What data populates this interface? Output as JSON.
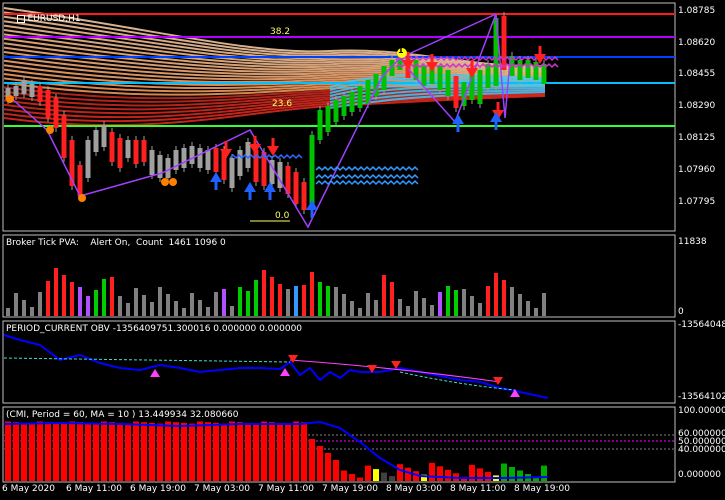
{
  "window": {
    "symbol_title": "EURUSD,H1",
    "symbol_icon": "chart-menu-icon"
  },
  "colors": {
    "background": "#000000",
    "grid": "#2a2a2a",
    "bull_candle": "#00c000",
    "bear_candle": "#ff0000",
    "neutral_candle": "#808080",
    "fib_38_line": "#b000ff",
    "fib_high_line": "#ff0000",
    "level_blue": "#0040ff",
    "level_cyan": "#00c0ff",
    "level_green": "#33ff33",
    "zigzag": "#a040ff",
    "obv_line": "#0000ff",
    "cmi_line": "#0000ff",
    "cmi_bars": "#ff0000"
  },
  "main_chart": {
    "price_levels": [
      "1.08785",
      "1.08620",
      "1.08455",
      "1.08290",
      "1.08125",
      "1.07960",
      "1.07795"
    ],
    "fib_labels": [
      "38.2",
      "23.6",
      "0.0"
    ],
    "marker_labels": [
      "1",
      "0",
      "0",
      "0",
      "0"
    ]
  },
  "pane_pva": {
    "title": "Broker Tick PVA:    Alert On,  Count  1461 1096 0",
    "axis_top": "11838",
    "axis_bottom": "0"
  },
  "pane_obv": {
    "title": "PERIOD_CURRENT OBV -1356409751.300016 0.000000 0.000000",
    "axis_top": "-1356404889",
    "axis_bottom": "-1356410213"
  },
  "pane_cmi": {
    "title": "(CMI, Period = 60, MA = 10 ) 13.449934 32.080660",
    "axis_labels": [
      "100.000000",
      "60.000000",
      "50.000000",
      "40.000000",
      "0.000000"
    ]
  },
  "time_axis": [
    "6 May 2020",
    "6 May 11:00",
    "6 May 19:00",
    "7 May 03:00",
    "7 May 11:00",
    "7 May 19:00",
    "8 May 03:00",
    "8 May 11:00",
    "8 May 19:00"
  ]
}
